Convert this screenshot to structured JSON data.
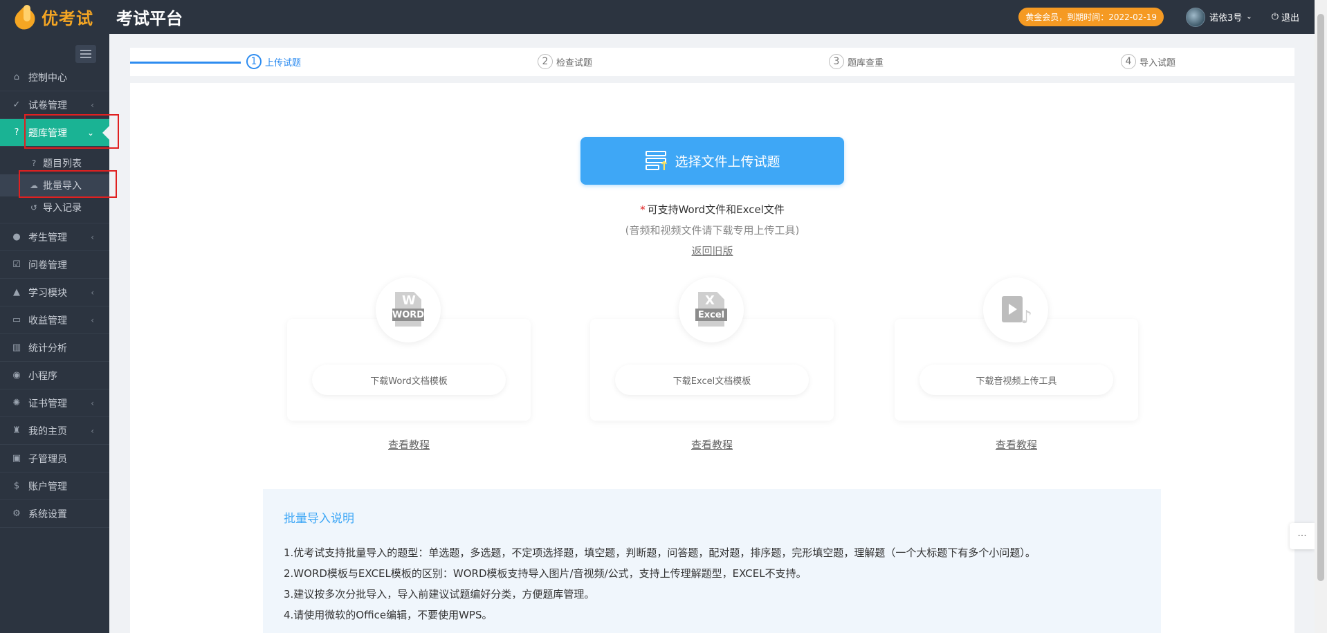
{
  "brand": {
    "name": "优考试",
    "platform_title": "考试平台"
  },
  "header": {
    "member_badge": "黄金会员，到期时间：2022-02-19",
    "username": "诺依3号",
    "logout": "退出"
  },
  "sidebar": {
    "items": [
      {
        "label": "控制中心",
        "icon": "home-icon"
      },
      {
        "label": "试卷管理",
        "icon": "check-circle-icon"
      },
      {
        "label": "题库管理",
        "icon": "question-circle-icon"
      },
      {
        "label": "考生管理",
        "icon": "user-icon"
      },
      {
        "label": "问卷管理",
        "icon": "checkbox-icon"
      },
      {
        "label": "学习模块",
        "icon": "graduation-cap-icon"
      },
      {
        "label": "收益管理",
        "icon": "money-icon"
      },
      {
        "label": "统计分析",
        "icon": "bar-chart-icon"
      },
      {
        "label": "小程序",
        "icon": "wechat-icon"
      },
      {
        "label": "证书管理",
        "icon": "certificate-icon"
      },
      {
        "label": "我的主页",
        "icon": "home-page-icon"
      },
      {
        "label": "子管理员",
        "icon": "lock-icon"
      },
      {
        "label": "账户管理",
        "icon": "dollar-icon"
      },
      {
        "label": "系统设置",
        "icon": "gear-icon"
      }
    ],
    "submenu": [
      {
        "label": "题目列表",
        "icon": "question-small-icon"
      },
      {
        "label": "批量导入",
        "icon": "cloud-upload-icon"
      },
      {
        "label": "导入记录",
        "icon": "history-icon"
      }
    ]
  },
  "steps": [
    {
      "num": "1",
      "label": "上传试题"
    },
    {
      "num": "2",
      "label": "检查试题"
    },
    {
      "num": "3",
      "label": "题库查重"
    },
    {
      "num": "4",
      "label": "导入试题"
    }
  ],
  "upload": {
    "button_label": "选择文件上传试题",
    "hint_star": "*",
    "hint_support": "可支持Word文件和Excel文件",
    "hint_media": "(音频和视频文件请下载专用上传工具)",
    "old_version": "返回旧版"
  },
  "cards": [
    {
      "icon_tag": "WORD",
      "icon_letter": "W",
      "button": "下载Word文档模板",
      "tutorial": "查看教程"
    },
    {
      "icon_tag": "Excel",
      "icon_letter": "X",
      "button": "下载Excel文档模板",
      "tutorial": "查看教程"
    },
    {
      "button": "下载音视频上传工具",
      "tutorial": "查看教程"
    }
  ],
  "info": {
    "title": "批量导入说明",
    "lines": [
      "1.优考试支持批量导入的题型：单选题，多选题，不定项选择题，填空题，判断题，问答题，配对题，排序题，完形填空题，理解题（一个大标题下有多个小问题）。",
      "2.WORD模板与EXCEL模板的区别：WORD模板支持导入图片/音视频/公式，支持上传理解题型，EXCEL不支持。",
      "3.建议按多次分批导入，导入前建议试题编好分类，方便题库管理。",
      "4.请使用微软的Office编辑，不要使用WPS。"
    ]
  },
  "colors": {
    "accent": "#1ab394",
    "primary": "#3ea7f6",
    "badge": "#f59a23",
    "sidebar": "#2c3440"
  }
}
